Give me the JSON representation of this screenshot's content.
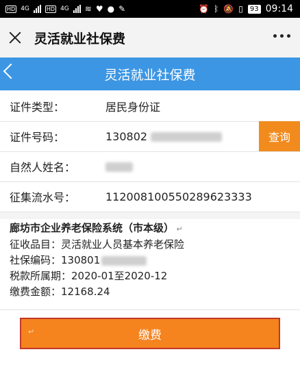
{
  "status_bar": {
    "network_1": "4G",
    "network_2": "4G",
    "battery": "93",
    "time": "09:14"
  },
  "app_header": {
    "title": "灵活就业社保费"
  },
  "page_bar": {
    "title": "灵活就业社保费"
  },
  "form": {
    "id_type_label": "证件类型：",
    "id_type_value": "居民身份证",
    "id_number_label": "证件号码：",
    "id_number_value": "130802",
    "query_label": "查询",
    "name_label": "自然人姓名：",
    "serial_label": "征集流水号：",
    "serial_value": "112008100550289623333"
  },
  "info": {
    "title": "廊坊市企业养老保险系统（市本级）",
    "item_label": "征收品目：灵活就业人员基本养老保险",
    "code_label": "社保编码：130801",
    "period_label": "税款所属期：2020-01至2020-12",
    "amount_label": "缴费金额：12168.24"
  },
  "pay_button": {
    "label": "缴费"
  }
}
